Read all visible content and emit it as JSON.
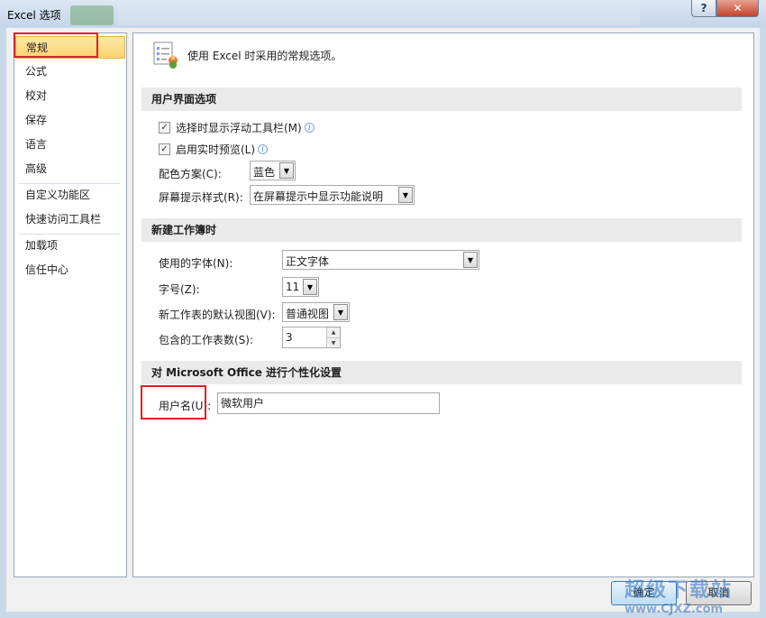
{
  "window": {
    "title": "Excel 选项",
    "help_glyph": "?",
    "close_glyph": "✕"
  },
  "sidebar": {
    "items": [
      {
        "label": "常规"
      },
      {
        "label": "公式"
      },
      {
        "label": "校对"
      },
      {
        "label": "保存"
      },
      {
        "label": "语言"
      },
      {
        "label": "高级"
      },
      {
        "label": "自定义功能区"
      },
      {
        "label": "快速访问工具栏"
      },
      {
        "label": "加载项"
      },
      {
        "label": "信任中心"
      }
    ],
    "selected": "常规"
  },
  "content": {
    "header_text": "使用 Excel 时采用的常规选项。",
    "ui_section": {
      "title": "用户界面选项",
      "show_mini_toolbar": {
        "label": "选择时显示浮动工具栏(M)",
        "checked": true
      },
      "live_preview": {
        "label": "启用实时预览(L)",
        "checked": true
      },
      "color_scheme": {
        "label": "配色方案(C):",
        "value": "蓝色"
      },
      "screentip_style": {
        "label": "屏幕提示样式(R):",
        "value": "在屏幕提示中显示功能说明"
      }
    },
    "workbook_section": {
      "title": "新建工作簿时",
      "font": {
        "label": "使用的字体(N):",
        "value": "正文字体"
      },
      "font_size": {
        "label": "字号(Z):",
        "value": "11"
      },
      "default_view": {
        "label": "新工作表的默认视图(V):",
        "value": "普通视图"
      },
      "sheet_count": {
        "label": "包含的工作表数(S):",
        "value": "3"
      }
    },
    "personalize_section": {
      "title": "对 Microsoft Office 进行个性化设置",
      "username": {
        "label": "用户名(U):",
        "value": "微软用户"
      }
    }
  },
  "footer": {
    "ok_label": "确定",
    "cancel_label": "取消"
  },
  "watermark": {
    "line1": "超级下载站",
    "line2": "www.CJXZ.com"
  },
  "colors": {
    "highlight": "#e02020",
    "selected_nav": "#fbd36f",
    "accent": "#3c7fb1"
  }
}
